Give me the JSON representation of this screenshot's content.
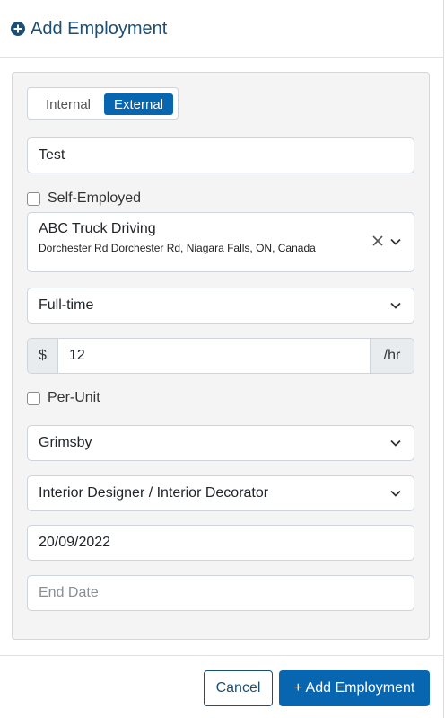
{
  "header": {
    "title": "Add Employment",
    "icon": "plus-circle-icon"
  },
  "type_toggle": {
    "options": [
      "Internal",
      "External"
    ],
    "selected": "External"
  },
  "name_field": {
    "value": "Test"
  },
  "self_employed": {
    "label": "Self-Employed",
    "checked": false
  },
  "employer": {
    "name": "ABC Truck Driving",
    "address": "Dorchester Rd Dorchester Rd, Niagara Falls, ON, Canada"
  },
  "employment_type": {
    "value": "Full-time"
  },
  "wage": {
    "prefix": "$",
    "value": "12",
    "suffix": "/hr"
  },
  "per_unit": {
    "label": "Per-Unit",
    "checked": false
  },
  "location": {
    "value": "Grimsby"
  },
  "occupation": {
    "value": "Interior Designer / Interior Decorator"
  },
  "start_date": {
    "value": "20/09/2022"
  },
  "end_date": {
    "value": "",
    "placeholder": "End Date"
  },
  "footer": {
    "cancel_label": "Cancel",
    "add_label": "+ Add Employment"
  },
  "colors": {
    "primary": "#0866b0",
    "title": "#1d4f73",
    "panel": "#f4f4f4"
  }
}
